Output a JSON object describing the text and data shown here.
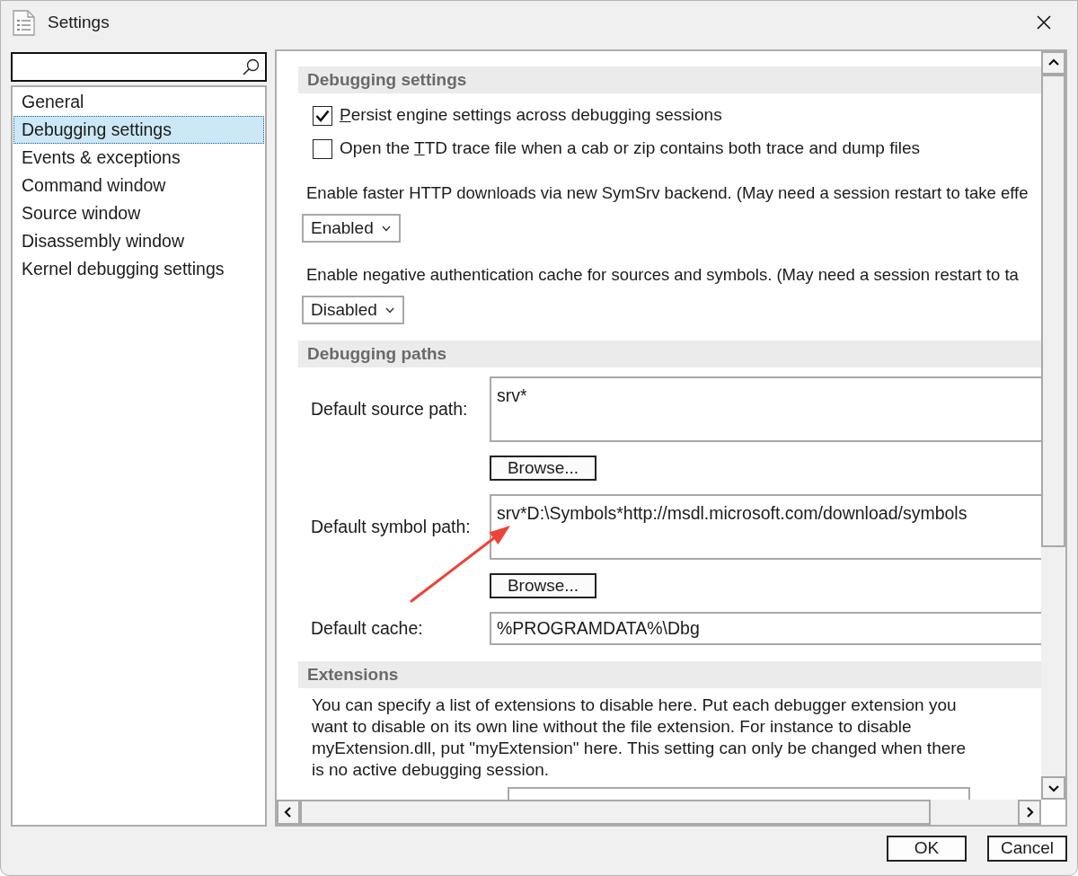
{
  "window": {
    "title": "Settings"
  },
  "sidebar": {
    "items": [
      {
        "label": "General",
        "selected": false
      },
      {
        "label": "Debugging settings",
        "selected": true
      },
      {
        "label": "Events & exceptions",
        "selected": false
      },
      {
        "label": "Command window",
        "selected": false
      },
      {
        "label": "Source window",
        "selected": false
      },
      {
        "label": "Disassembly window",
        "selected": false
      },
      {
        "label": "Kernel debugging settings",
        "selected": false
      }
    ]
  },
  "sections": [
    {
      "title": "Debugging settings",
      "items": [
        {
          "kind": "checkbox",
          "checked": true,
          "access_key": "P",
          "label_end": "ersist engine settings across debugging sessions"
        },
        {
          "kind": "checkbox",
          "checked": false,
          "label_start": "Open the ",
          "access_key": "T",
          "label_end": "TD trace file when a cab or zip contains both trace and dump files"
        },
        {
          "kind": "dropdown",
          "label": "Enable faster HTTP downloads via new SymSrv backend. (May need a session restart to take effe",
          "value": "Enabled"
        },
        {
          "kind": "dropdown",
          "label": "Enable negative authentication cache for sources and symbols. (May need a session restart to ta",
          "value": "Disabled"
        }
      ]
    },
    {
      "title": "Debugging paths",
      "items": [
        {
          "kind": "path",
          "label": "Default source path:",
          "value": "srv*",
          "button": "Browse..."
        },
        {
          "kind": "path",
          "label": "Default symbol path:",
          "value": "srv*D:\\Symbols*http://msdl.microsoft.com/download/symbols",
          "button": "Browse..."
        },
        {
          "kind": "text",
          "label": "Default cache:",
          "value": "%PROGRAMDATA%\\Dbg"
        }
      ]
    },
    {
      "title": "Extensions",
      "items": [
        {
          "kind": "note",
          "text": "You can specify a list of extensions to disable here. Put each debugger extension you want to disable on its own line without the file extension. For instance to disable myExtension.dll, put \"myExtension\" here. This setting can only be changed when there is no active debugging session."
        },
        {
          "kind": "list"
        }
      ]
    }
  ],
  "buttons": [
    "OK",
    "Cancel"
  ]
}
